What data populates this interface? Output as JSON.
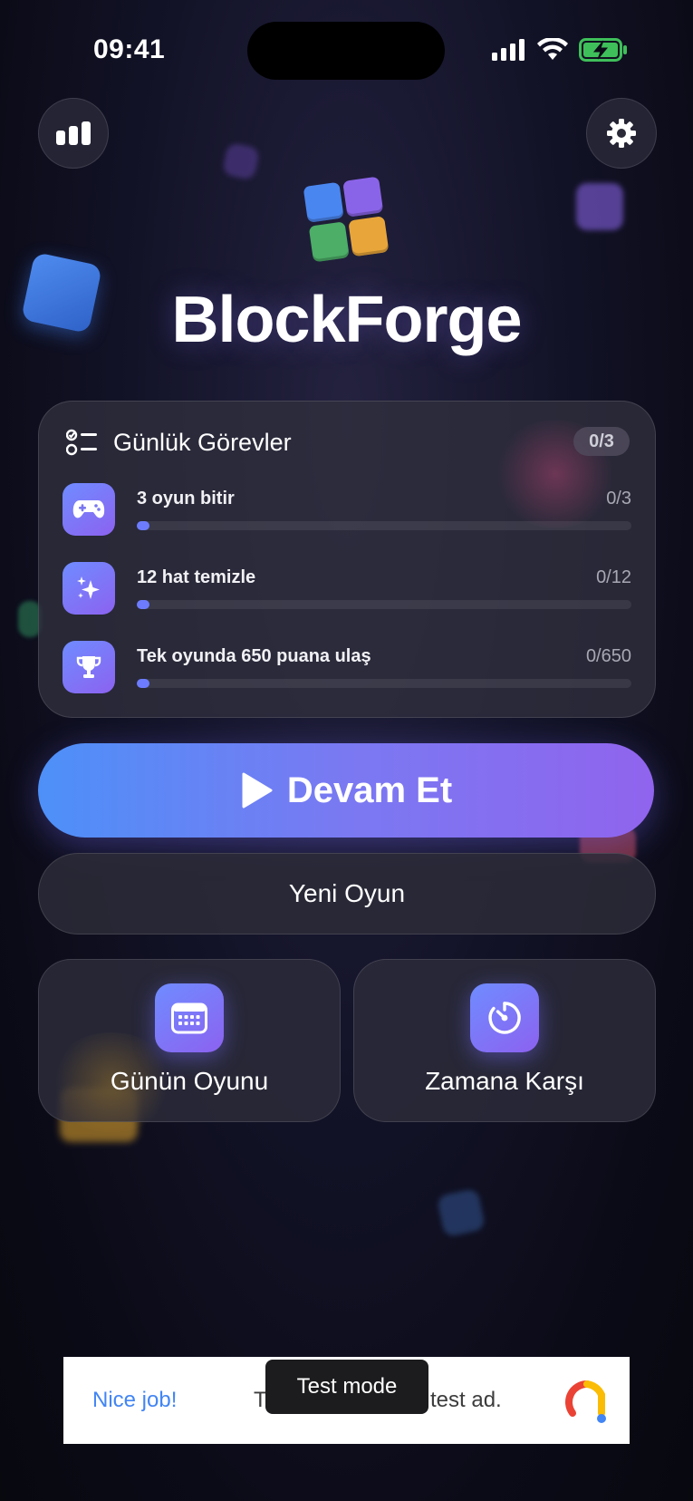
{
  "status_bar": {
    "time": "09:41"
  },
  "header": {
    "app_title": "BlockForge",
    "stats_icon": "bar-chart-icon",
    "settings_icon": "gear-icon",
    "logo_colors": [
      "#4a86ef",
      "#8a64e8",
      "#4cae67",
      "#e8a63a"
    ]
  },
  "daily_tasks": {
    "title": "Günlük Görevler",
    "completed_badge": "0/3",
    "items": [
      {
        "icon": "gamepad-icon",
        "label": "3 oyun bitir",
        "progress_text": "0/3",
        "progress": 0
      },
      {
        "icon": "sparkles-icon",
        "label": "12 hat temizle",
        "progress_text": "0/12",
        "progress": 0
      },
      {
        "icon": "trophy-icon",
        "label": "Tek oyunda 650 puana ulaş",
        "progress_text": "0/650",
        "progress": 0
      }
    ]
  },
  "actions": {
    "continue_label": "Devam Et",
    "continue_icon": "play-icon",
    "new_game_label": "Yeni Oyun"
  },
  "modes": {
    "daily": {
      "label": "Günün Oyunu",
      "icon": "calendar-icon"
    },
    "timed": {
      "label": "Zamana Karşı",
      "icon": "timer-icon"
    }
  },
  "ad": {
    "headline": "Nice job!",
    "text_left": "T",
    "text_right": "test ad.",
    "test_mode_label": "Test mode"
  },
  "colors": {
    "accent_start": "#4d90f8",
    "accent_end": "#9064ee",
    "background": "#0b0b18"
  }
}
